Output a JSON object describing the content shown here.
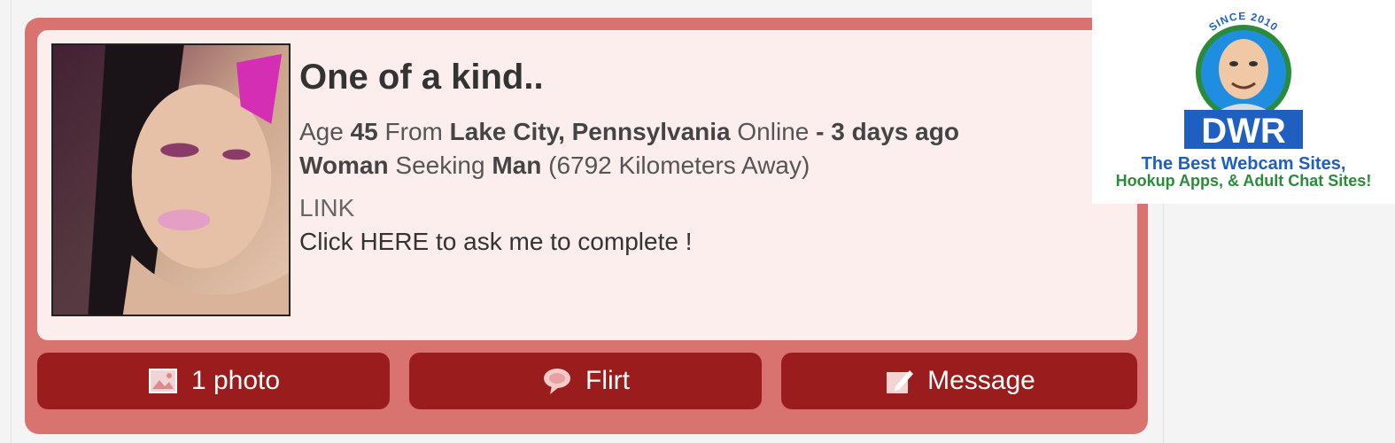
{
  "profile": {
    "headline": "One of a kind..",
    "age_label": "Age",
    "age": "45",
    "from_label": "From",
    "location": "Lake City, Pennsylvania",
    "online_label": "Online",
    "last_online": "- 3 days ago",
    "gender": "Woman",
    "seeking_label": "Seeking",
    "seeking": "Man",
    "distance": "(6792 Kilometers Away)",
    "link_label": "LINK",
    "complete_prompt": "Click HERE to ask me to complete !"
  },
  "actions": {
    "photos_label": "1 photo",
    "flirt_label": "Flirt",
    "message_label": "Message"
  },
  "logo": {
    "since_text": "SINCE 2010",
    "brand": "DWR",
    "tagline_1": "The Best Webcam Sites,",
    "tagline_2": "Hookup Apps, & Adult Chat Sites!"
  },
  "colors": {
    "card_border": "#d9736f",
    "card_background": "#fdeeee",
    "button_background": "#9b1c1c",
    "logo_blue": "#1f5fc1",
    "logo_green": "#2a8c3a"
  },
  "icons": {
    "photo_button": "image-icon",
    "flirt_button": "speech-bubble-icon",
    "message_button": "edit-note-icon"
  }
}
